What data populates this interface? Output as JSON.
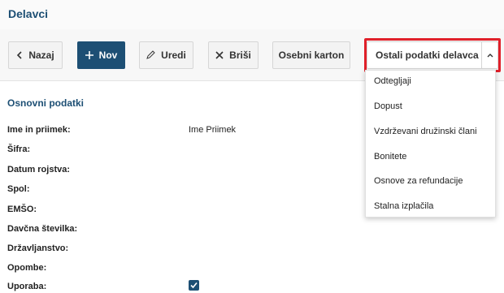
{
  "header": {
    "title": "Delavci"
  },
  "toolbar": {
    "back_label": "Nazaj",
    "new_label": "Nov",
    "edit_label": "Uredi",
    "delete_label": "Briši",
    "card_label": "Osebni karton",
    "other_label": "Ostali podatki delavca",
    "accent_color": "#1d4f74",
    "highlight_color": "#e0202a"
  },
  "dropdown": {
    "items": [
      "Odtegljaji",
      "Dopust",
      "Vzdrževani družinski člani",
      "Bonitete",
      "Osnove za refundacije",
      "Stalna izplačila"
    ]
  },
  "section": {
    "title": "Osnovni podatki"
  },
  "fields": [
    {
      "label": "Ime in priimek:",
      "value": "Ime Priimek"
    },
    {
      "label": "Šifra:",
      "value": ""
    },
    {
      "label": "Datum rojstva:",
      "value": ""
    },
    {
      "label": "Spol:",
      "value": ""
    },
    {
      "label": "EMŠO:",
      "value": ""
    },
    {
      "label": "Davčna številka:",
      "value": ""
    },
    {
      "label": "Državljanstvo:",
      "value": ""
    },
    {
      "label": "Opombe:",
      "value": ""
    },
    {
      "label": "Uporaba:",
      "value": ""
    }
  ],
  "usage_checked": true
}
